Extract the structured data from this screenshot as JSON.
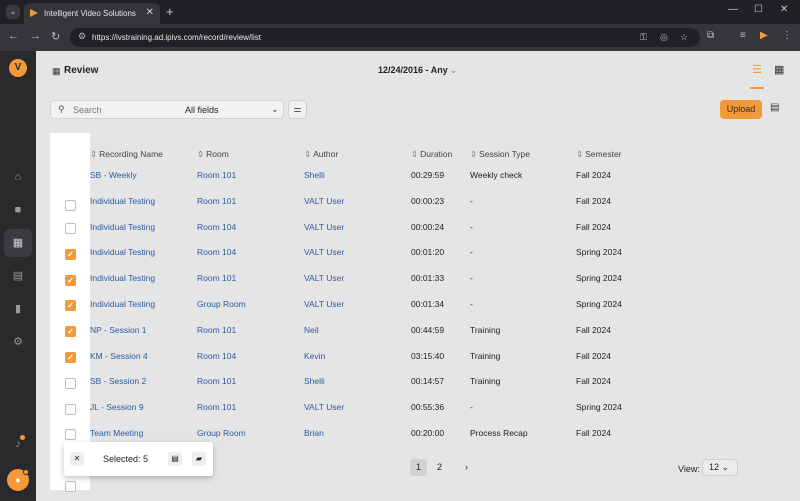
{
  "browser": {
    "tab_title": "Intelligent Video Solutions",
    "url": "https://ivstraining.ad.ipivs.com/record/review/list"
  },
  "header": {
    "title": "Review",
    "date_filter": "12/24/2016 - Any"
  },
  "toolbar": {
    "search_placeholder": "Search",
    "field_select": "All fields",
    "upload_label": "Upload"
  },
  "table": {
    "columns": [
      "Recording Name",
      "Room",
      "Author",
      "Duration",
      "Session Type",
      "Semester"
    ],
    "rows": [
      {
        "checked": false,
        "name": "SB - Weekly",
        "room": "Room 101",
        "author": "Shelli",
        "duration": "00:29:59",
        "session_type": "Weekly check",
        "semester": "Fall 2024"
      },
      {
        "checked": true,
        "name": "Individual Testing",
        "room": "Room 101",
        "author": "VALT User",
        "duration": "00:00:23",
        "session_type": "-",
        "semester": "Fall 2024"
      },
      {
        "checked": true,
        "name": "Individual Testing",
        "room": "Room 104",
        "author": "VALT User",
        "duration": "00:00:24",
        "session_type": "-",
        "semester": "Fall 2024"
      },
      {
        "checked": true,
        "name": "Individual Testing",
        "room": "Room 104",
        "author": "VALT User",
        "duration": "00:01:20",
        "session_type": "-",
        "semester": "Spring 2024"
      },
      {
        "checked": true,
        "name": "Individual Testing",
        "room": "Room 101",
        "author": "VALT User",
        "duration": "00:01:33",
        "session_type": "-",
        "semester": "Spring 2024"
      },
      {
        "checked": true,
        "name": "Individual Testing",
        "room": "Group Room",
        "author": "VALT User",
        "duration": "00:01:34",
        "session_type": "-",
        "semester": "Spring 2024"
      },
      {
        "checked": false,
        "name": "NP - Session 1",
        "room": "Room 101",
        "author": "Neil",
        "duration": "00:44:59",
        "session_type": "Training",
        "semester": "Fall 2024"
      },
      {
        "checked": false,
        "name": "KM - Session 4",
        "room": "Room 104",
        "author": "Kevin",
        "duration": "03:15:40",
        "session_type": "Training",
        "semester": "Fall 2024"
      },
      {
        "checked": false,
        "name": "SB - Session 2",
        "room": "Room 101",
        "author": "Shelli",
        "duration": "00:14:57",
        "session_type": "Training",
        "semester": "Fall 2024"
      },
      {
        "checked": false,
        "name": "JL - Session 9",
        "room": "Room 101",
        "author": "VALT User",
        "duration": "00:55:36",
        "session_type": "-",
        "semester": "Spring 2024"
      },
      {
        "checked": false,
        "name": "Team Meeting",
        "room": "Group Room",
        "author": "Brian",
        "duration": "00:20:00",
        "session_type": "Process Recap",
        "semester": "Fall 2024"
      }
    ]
  },
  "pagination": {
    "pages": [
      "1",
      "2"
    ],
    "current": "1",
    "view_label": "View:",
    "view_value": "12"
  },
  "selection_popup": {
    "text": "Selected: 5"
  },
  "colors": {
    "accent": "#f29a3a",
    "link": "#2d5a9e",
    "sidebar": "#2a2a2c"
  }
}
